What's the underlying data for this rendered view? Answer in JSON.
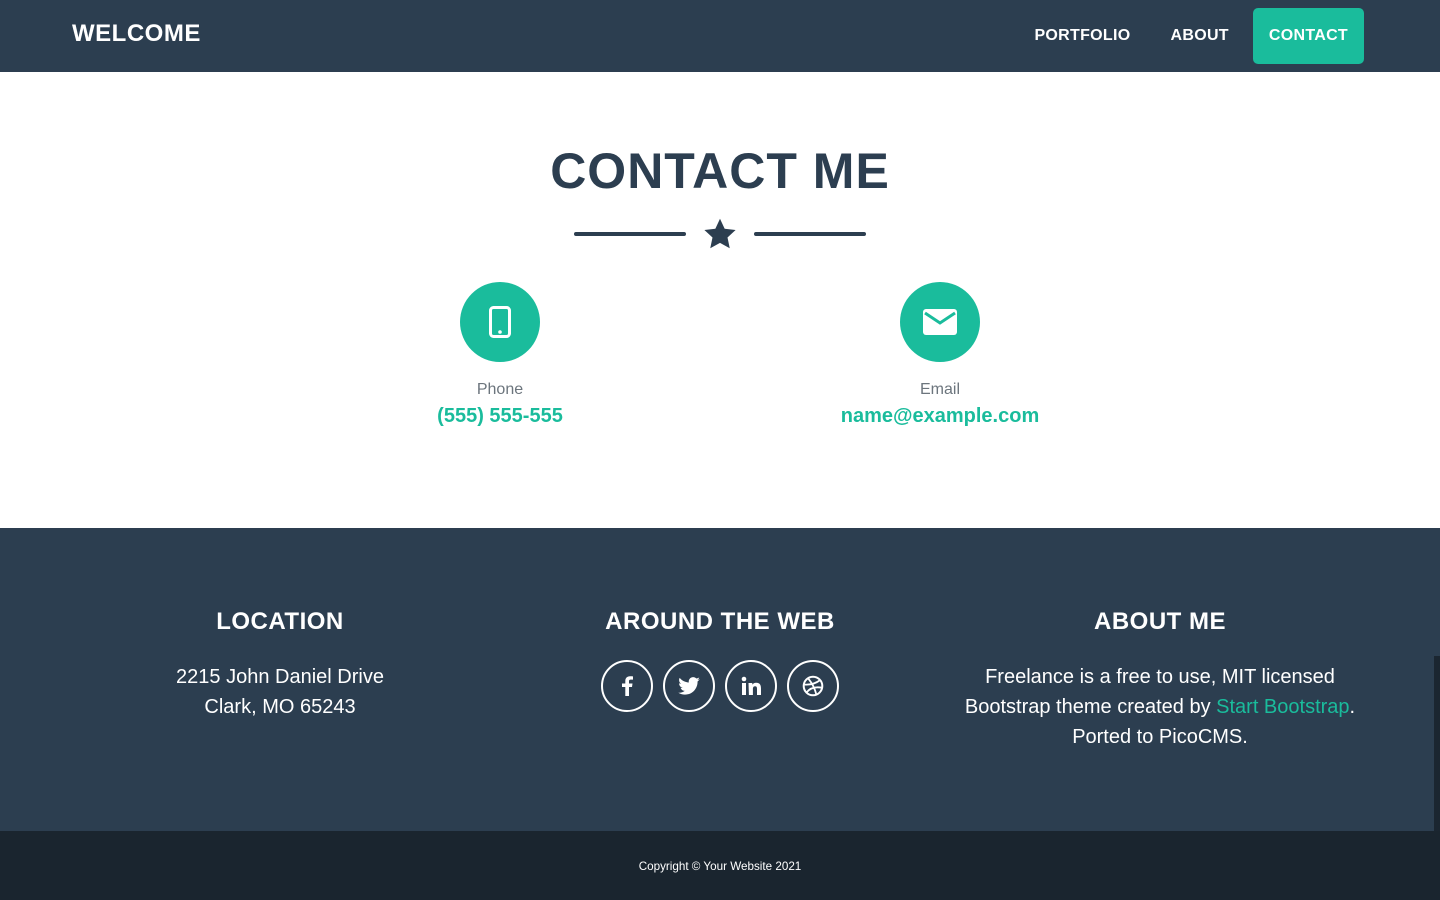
{
  "navbar": {
    "brand": "WELCOME",
    "links": [
      {
        "label": "PORTFOLIO"
      },
      {
        "label": "ABOUT"
      },
      {
        "label": "CONTACT"
      }
    ]
  },
  "contact": {
    "title": "CONTACT ME",
    "phone": {
      "label": "Phone",
      "value": "(555) 555-555",
      "icon": "mobile-phone-icon"
    },
    "email": {
      "label": "Email",
      "value": "name@example.com",
      "icon": "envelope-icon"
    }
  },
  "footer": {
    "location": {
      "heading": "LOCATION",
      "line1": "2215 John Daniel Drive",
      "line2": "Clark, MO 65243"
    },
    "web": {
      "heading": "AROUND THE WEB",
      "icons": [
        "facebook-icon",
        "twitter-icon",
        "linkedin-icon",
        "dribbble-icon"
      ]
    },
    "about": {
      "heading": "ABOUT ME",
      "text_before": "Freelance is a free to use, MIT licensed Bootstrap theme created by ",
      "link": "Start Bootstrap",
      "text_after": ". Ported to PicoCMS."
    }
  },
  "copyright": "Copyright © Your Website 2021",
  "colors": {
    "primary": "#2c3e50",
    "accent": "#1abc9c",
    "dark": "#1a252f"
  }
}
